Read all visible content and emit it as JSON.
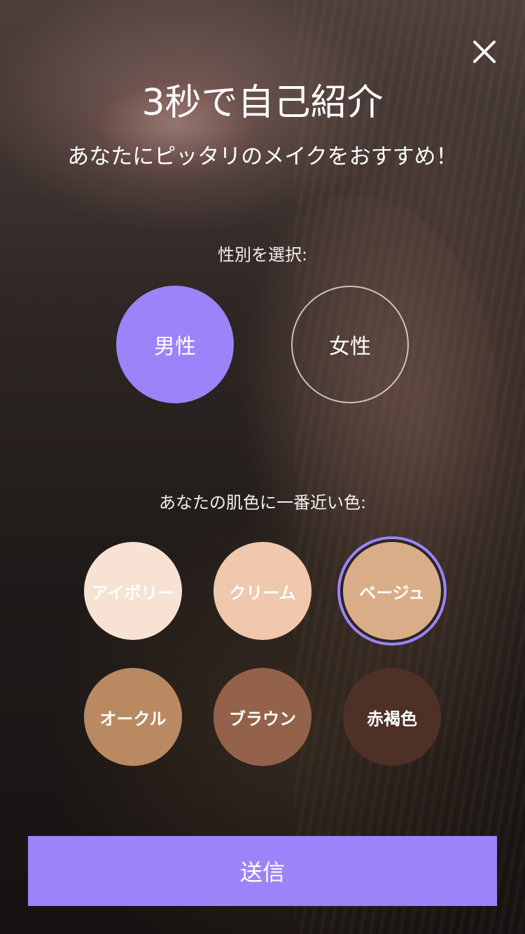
{
  "header": {
    "title": "3秒で自己紹介",
    "subtitle": "あなたにピッタリのメイクをおすすめ！"
  },
  "close_icon": "close-icon",
  "gender": {
    "label": "性別を選択:",
    "options": [
      {
        "label": "男性",
        "selected": true
      },
      {
        "label": "女性",
        "selected": false
      }
    ]
  },
  "skin": {
    "label": "あなたの肌色に一番近い色:",
    "options": [
      {
        "label": "アイボリー",
        "color": "#f8e2d4",
        "selected": false
      },
      {
        "label": "クリーム",
        "color": "#efc8ad",
        "selected": false
      },
      {
        "label": "ベージュ",
        "color": "#d9ad87",
        "selected": true
      },
      {
        "label": "オークル",
        "color": "#b98a62",
        "selected": false
      },
      {
        "label": "ブラウン",
        "color": "#94624a",
        "selected": false
      },
      {
        "label": "赤褐色",
        "color": "#4e3027",
        "selected": false
      }
    ]
  },
  "submit": {
    "label": "送信",
    "color": "#9b84fa"
  },
  "accent_color": "#9b84fa"
}
